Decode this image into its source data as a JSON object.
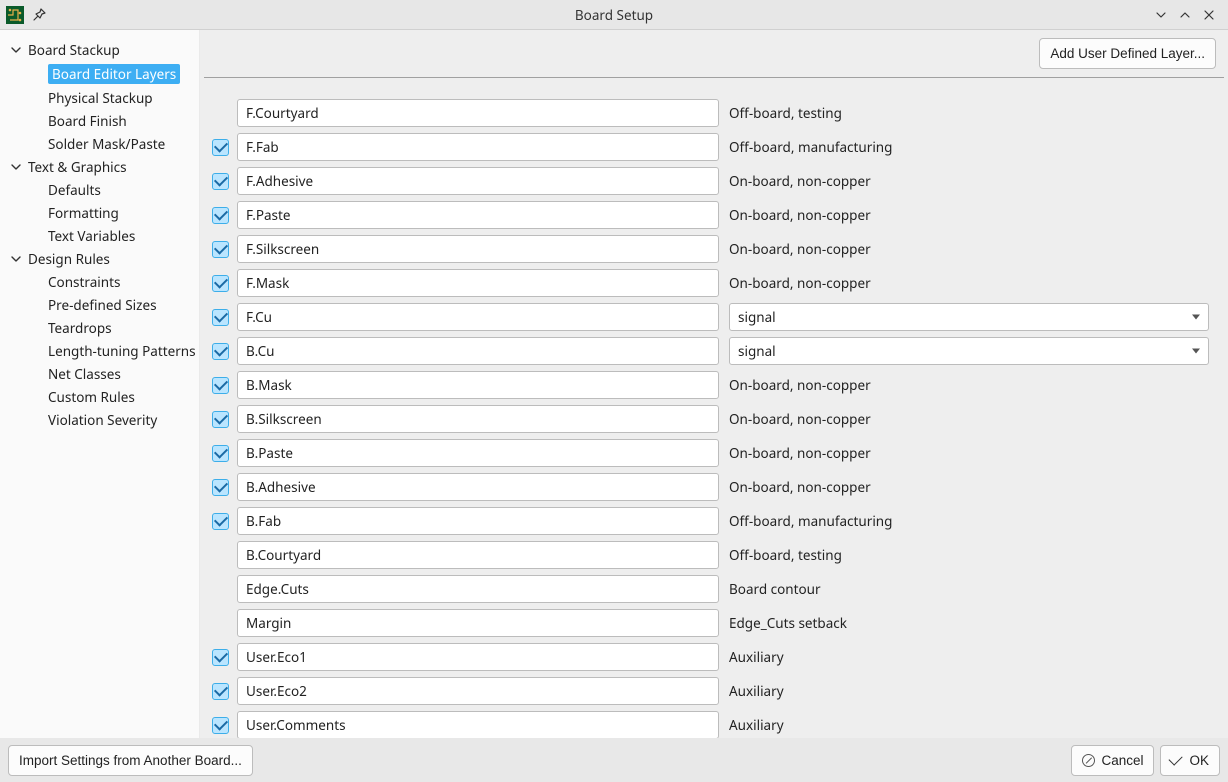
{
  "title": "Board Setup",
  "header_button": "Add User Defined Layer...",
  "sidebar": {
    "sections": [
      {
        "label": "Board Stackup",
        "expanded": true,
        "children": [
          {
            "label": "Board Editor Layers",
            "selected": true
          },
          {
            "label": "Physical Stackup"
          },
          {
            "label": "Board Finish"
          },
          {
            "label": "Solder Mask/Paste"
          }
        ]
      },
      {
        "label": "Text & Graphics",
        "expanded": true,
        "children": [
          {
            "label": "Defaults"
          },
          {
            "label": "Formatting"
          },
          {
            "label": "Text Variables"
          }
        ]
      },
      {
        "label": "Design Rules",
        "expanded": true,
        "children": [
          {
            "label": "Constraints"
          },
          {
            "label": "Pre-defined Sizes"
          },
          {
            "label": "Teardrops"
          },
          {
            "label": "Length-tuning Patterns"
          },
          {
            "label": "Net Classes"
          },
          {
            "label": "Custom Rules"
          },
          {
            "label": "Violation Severity"
          }
        ]
      }
    ]
  },
  "layers": [
    {
      "name": "F.Courtyard",
      "checked": null,
      "type_kind": "text",
      "type": "Off-board, testing"
    },
    {
      "name": "F.Fab",
      "checked": true,
      "type_kind": "text",
      "type": "Off-board, manufacturing"
    },
    {
      "name": "F.Adhesive",
      "checked": true,
      "type_kind": "text",
      "type": "On-board, non-copper"
    },
    {
      "name": "F.Paste",
      "checked": true,
      "type_kind": "text",
      "type": "On-board, non-copper"
    },
    {
      "name": "F.Silkscreen",
      "checked": true,
      "type_kind": "text",
      "type": "On-board, non-copper"
    },
    {
      "name": "F.Mask",
      "checked": true,
      "type_kind": "text",
      "type": "On-board, non-copper"
    },
    {
      "name": "F.Cu",
      "checked": true,
      "type_kind": "select",
      "type": "signal"
    },
    {
      "name": "B.Cu",
      "checked": true,
      "type_kind": "select",
      "type": "signal"
    },
    {
      "name": "B.Mask",
      "checked": true,
      "type_kind": "text",
      "type": "On-board, non-copper"
    },
    {
      "name": "B.Silkscreen",
      "checked": true,
      "type_kind": "text",
      "type": "On-board, non-copper"
    },
    {
      "name": "B.Paste",
      "checked": true,
      "type_kind": "text",
      "type": "On-board, non-copper"
    },
    {
      "name": "B.Adhesive",
      "checked": true,
      "type_kind": "text",
      "type": "On-board, non-copper"
    },
    {
      "name": "B.Fab",
      "checked": true,
      "type_kind": "text",
      "type": "Off-board, manufacturing"
    },
    {
      "name": "B.Courtyard",
      "checked": null,
      "type_kind": "text",
      "type": "Off-board, testing"
    },
    {
      "name": "Edge.Cuts",
      "checked": null,
      "type_kind": "text",
      "type": "Board contour"
    },
    {
      "name": "Margin",
      "checked": null,
      "type_kind": "text",
      "type": "Edge_Cuts setback"
    },
    {
      "name": "User.Eco1",
      "checked": true,
      "type_kind": "text",
      "type": "Auxiliary"
    },
    {
      "name": "User.Eco2",
      "checked": true,
      "type_kind": "text",
      "type": "Auxiliary"
    },
    {
      "name": "User.Comments",
      "checked": true,
      "type_kind": "text",
      "type": "Auxiliary"
    }
  ],
  "footer": {
    "import": "Import Settings from Another Board...",
    "cancel": "Cancel",
    "ok": "OK"
  }
}
